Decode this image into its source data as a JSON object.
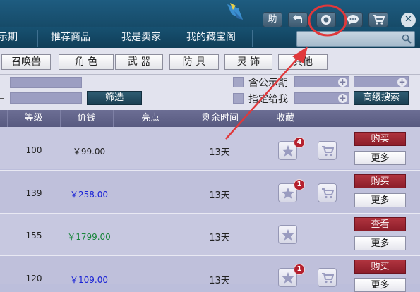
{
  "titlebar": {
    "help_label": "助",
    "buttons": [
      "back-icon",
      "record-icon",
      "chat-icon",
      "cart-icon",
      "close-icon"
    ],
    "close_label": "✕"
  },
  "nav": {
    "tabs": [
      {
        "label": "示期"
      },
      {
        "label": "推荐商品"
      },
      {
        "label": "我是卖家"
      },
      {
        "label": "我的藏宝阁"
      }
    ]
  },
  "categories": [
    "召唤兽",
    "角 色",
    "武 器",
    "防 具",
    "灵 饰",
    "其他"
  ],
  "filters": {
    "filter_button": "筛选",
    "public_label": "含公示期",
    "designated_label": "指定给我",
    "advanced_button": "高级搜索"
  },
  "table": {
    "headers": [
      "等级",
      "价钱",
      "亮点",
      "剩余时间",
      "收藏"
    ],
    "rows": [
      {
        "level": "100",
        "price": "￥99.00",
        "price_color": "#222222",
        "time": "13天",
        "fav_count": "4",
        "action": "购买",
        "more": "更多"
      },
      {
        "level": "139",
        "price": "￥258.00",
        "price_color": "#1a23d6",
        "time": "13天",
        "fav_count": "1",
        "action": "购买",
        "more": "更多"
      },
      {
        "level": "155",
        "price": "￥1799.00",
        "price_color": "#17843a",
        "time": "13天",
        "fav_count": "",
        "action": "查看",
        "more": "更多"
      },
      {
        "level": "120",
        "price": "￥109.00",
        "price_color": "#1a23d6",
        "time": "13天",
        "fav_count": "1",
        "action": "购买",
        "more": "更多"
      }
    ]
  },
  "colors": {
    "annotation": "#e0383b",
    "buy_button": "#a02935",
    "header_bg": "#1a5273"
  }
}
